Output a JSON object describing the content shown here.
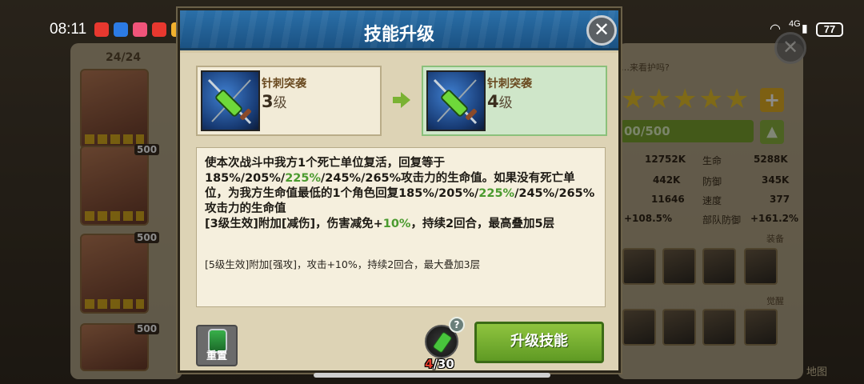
{
  "status_bar": {
    "time": "08:11",
    "network": "4G",
    "battery": "77"
  },
  "background": {
    "hero_count": "24/24",
    "hero_badges": [
      "500",
      "500",
      "500"
    ],
    "hint": "…来看护吗?",
    "progress": "00/500",
    "stats": [
      {
        "left_value": "12752K",
        "right_label": "生命",
        "right_value": "5288K"
      },
      {
        "left_value": "442K",
        "right_label": "防御",
        "right_value": "345K"
      },
      {
        "left_value": "11646",
        "right_label": "速度",
        "right_value": "377"
      },
      {
        "left_value": "+108.5%",
        "right_label": "部队防御",
        "right_value": "+161.2%"
      }
    ],
    "equip_label": "装备",
    "awaken_label": "觉醒",
    "map_label": "地图"
  },
  "modal": {
    "title": "技能升级",
    "current_skill": {
      "name": "针刺突袭",
      "level_num": "3",
      "level_suffix": "级"
    },
    "next_skill": {
      "name": "针刺突袭",
      "level_num": "4",
      "level_suffix": "级"
    },
    "description": {
      "p1_a": "使本次战斗中我方1个死亡单位复活，回复等于185%/205%/",
      "p1_hl": "225%",
      "p1_b": "/245%/265%攻击力的生命值。如果没有死亡单位，为我方生命值最低的1个角色回复185%/205%/",
      "p1_hl2": "225%",
      "p1_c": "/245%/265%攻击力的生命值",
      "p2_a": "[3级生效]附加[减伤]，伤害减免+",
      "p2_hl": "10%",
      "p2_b": "，持续2回合，最高叠加5层",
      "extra": "[5级生效]附加[强攻]，攻击+10%，持续2回合，最大叠加3层"
    },
    "reset_label": "重置",
    "item_have": "4",
    "item_need": "/30",
    "help_symbol": "?",
    "upgrade_label": "升级技能",
    "close_symbol": "✕"
  },
  "colors": {
    "header_blue": "#2a6fa8",
    "upgrade_green": "#7ab233",
    "highlight_green": "#4a9a2e",
    "insufficient_red": "#e23a2a"
  }
}
